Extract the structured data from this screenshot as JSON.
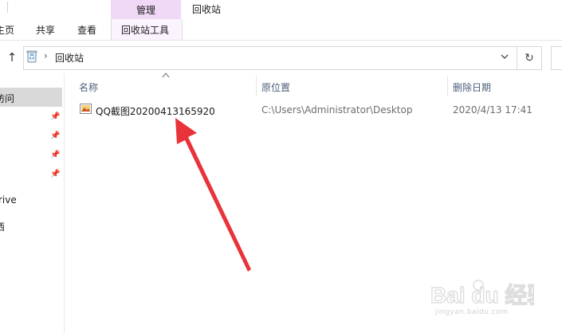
{
  "ribbon": {
    "context_header": "管理",
    "window_title": "回收站",
    "tabs": [
      "主页",
      "共享",
      "查看",
      "回收站工具"
    ]
  },
  "address_bar": {
    "crumb": "回收站"
  },
  "sidebar": {
    "items": [
      {
        "label": "访问"
      },
      {
        "label": ""
      },
      {
        "label": ""
      },
      {
        "label": ""
      },
      {
        "label": ""
      },
      {
        "label": "rive"
      },
      {
        "label": "西"
      }
    ]
  },
  "columns": [
    "名称",
    "原位置",
    "删除日期"
  ],
  "files": [
    {
      "name": "QQ截图20200413165920",
      "original_location": "C:\\Users\\Administrator\\Desktop",
      "deleted_date": "2020/4/13 17:41"
    }
  ],
  "watermark": {
    "logo_text": "Bai du 经验",
    "url": "jingyan.baidu.com"
  },
  "colors": {
    "context_tab": "#f0d9f7",
    "selection": "#d9d9d9",
    "arrow": "#e8333a",
    "header_text": "#4c607a"
  }
}
